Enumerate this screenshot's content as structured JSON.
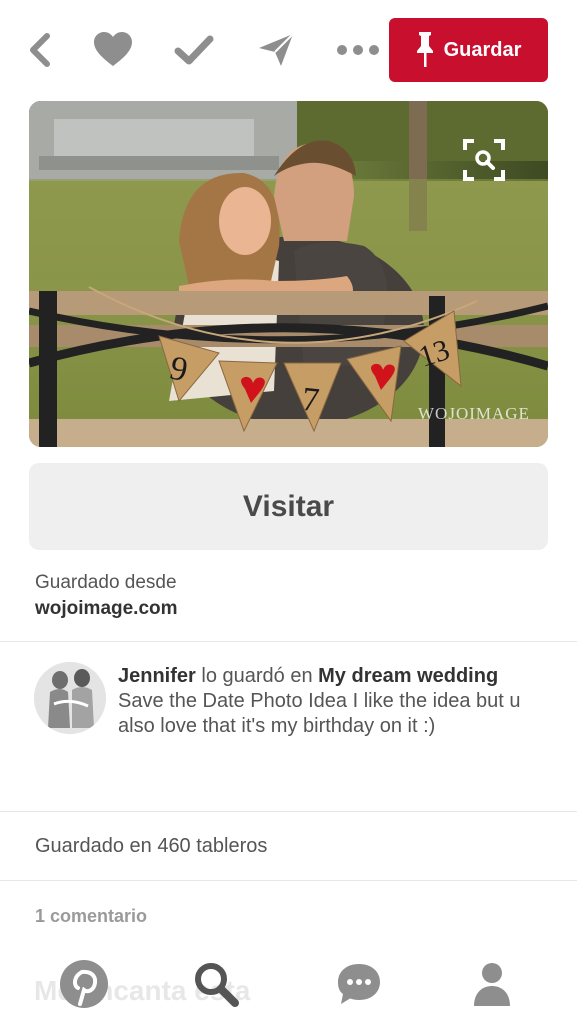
{
  "topbar": {
    "back_icon": "chevron-left-icon",
    "like_icon": "heart-icon",
    "done_icon": "checkmark-icon",
    "send_icon": "paper-plane-icon",
    "more_icon": "ellipsis-icon",
    "save_icon": "pushpin-icon",
    "save_label": "Guardar"
  },
  "pin": {
    "lens_icon": "visual-search-icon",
    "watermark": "WOJOIMAGE",
    "banner_letters": [
      "9",
      "♥",
      "7",
      "♥",
      "13"
    ],
    "visit_label": "Visitar",
    "saved_from_label": "Guardado desde",
    "source_domain": "wojoimage.com"
  },
  "saver": {
    "name": "Jennifer",
    "action": "lo guardó en",
    "board": "My dream wedding",
    "description": "Save the Date Photo Idea I like the idea but u also love that it's my birthday on it :)"
  },
  "stats": {
    "saved_count_text": "Guardado en 460 tableros"
  },
  "comments": {
    "count_text": "1 comentario",
    "partial_text": "Me encanta esta"
  },
  "nav": {
    "items": [
      "pinterest-logo-icon",
      "search-icon",
      "chat-bubble-icon",
      "person-icon"
    ]
  },
  "colors": {
    "brand_red": "#c8102e",
    "icon_gray": "#8e8e8e",
    "nav_icon": "#555555",
    "button_bg": "#efefef"
  }
}
